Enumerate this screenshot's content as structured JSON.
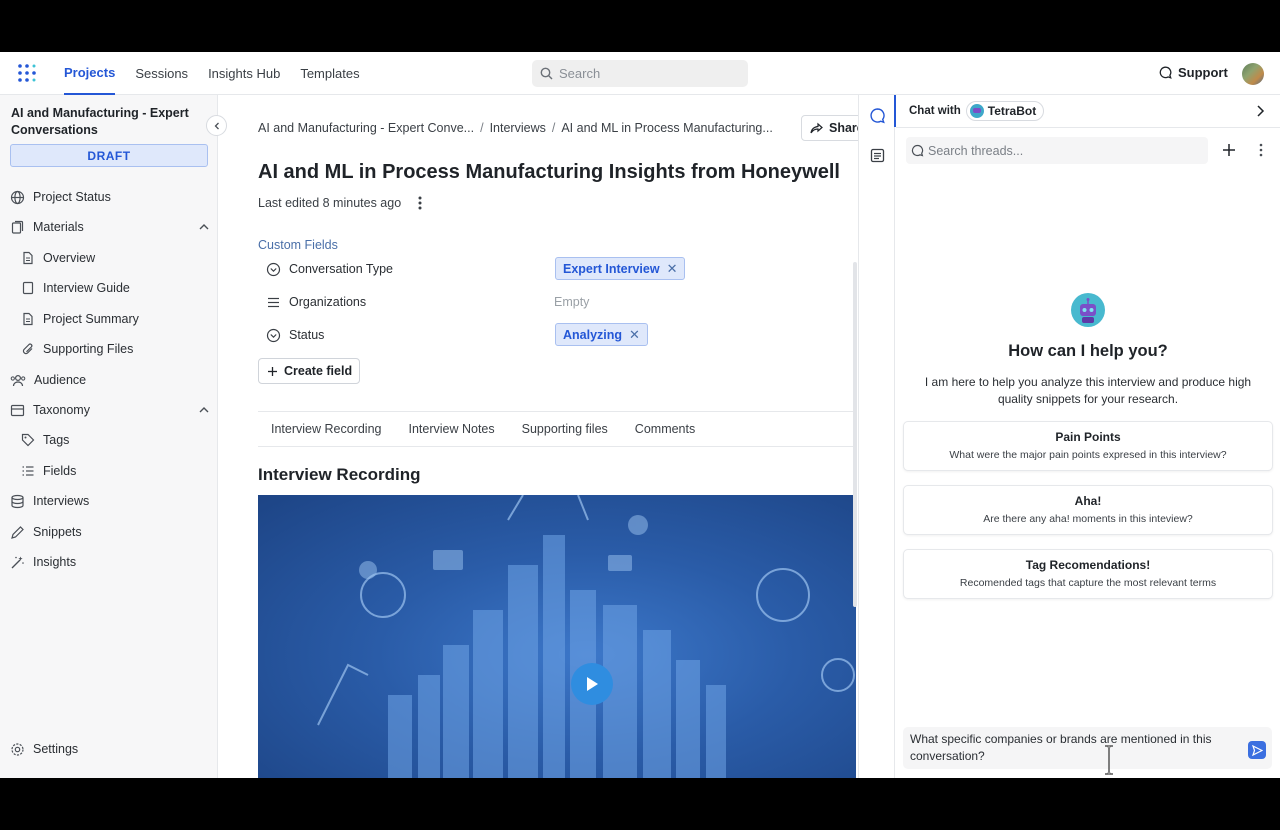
{
  "nav": {
    "links": [
      "Projects",
      "Sessions",
      "Insights Hub",
      "Templates"
    ],
    "search_placeholder": "Search",
    "support": "Support"
  },
  "sidebar": {
    "project_title": "AI and Manufacturing - Expert Conversations",
    "status_badge": "DRAFT",
    "items": {
      "project_status": "Project Status",
      "materials": "Materials",
      "overview": "Overview",
      "interview_guide": "Interview Guide",
      "project_summary": "Project Summary",
      "supporting_files": "Supporting Files",
      "audience": "Audience",
      "taxonomy": "Taxonomy",
      "tags": "Tags",
      "fields": "Fields",
      "interviews": "Interviews",
      "snippets": "Snippets",
      "insights": "Insights",
      "settings": "Settings"
    }
  },
  "main": {
    "breadcrumb": [
      "AI and Manufacturing - Expert Conve...",
      "Interviews",
      "AI and ML in Process Manufacturing..."
    ],
    "share": "Share",
    "title": "AI and ML in Process Manufacturing Insights from Honeywell",
    "last_edited": "Last edited 8 minutes ago",
    "custom_fields_label": "Custom Fields",
    "fields": {
      "conversation_type": {
        "label": "Conversation Type",
        "value": "Expert Interview"
      },
      "organizations": {
        "label": "Organizations",
        "value": "Empty"
      },
      "status": {
        "label": "Status",
        "value": "Analyzing"
      }
    },
    "create_field": "Create field",
    "tabs": [
      "Interview Recording",
      "Interview Notes",
      "Supporting files",
      "Comments"
    ],
    "section_title": "Interview Recording"
  },
  "chat": {
    "header_prefix": "Chat with",
    "bot_name": "TetraBot",
    "search_placeholder": "Search threads...",
    "help_title": "How can I help you?",
    "help_desc": "I am here to help you analyze this interview and produce high quality snippets for your research.",
    "suggestions": [
      {
        "title": "Pain Points",
        "desc": "What were the major pain points expresed in this interview?"
      },
      {
        "title": "Aha!",
        "desc": "Are there any aha! moments in this inteview?"
      },
      {
        "title": "Tag Recomendations!",
        "desc": "Recomended tags that capture the most relevant terms"
      }
    ],
    "input_value": "What specific companies or brands are mentioned in this conversation?"
  },
  "colors": {
    "accent": "#2457d6",
    "chip_bg": "#dfe8fb",
    "video_blue": "#2a5ca8"
  }
}
